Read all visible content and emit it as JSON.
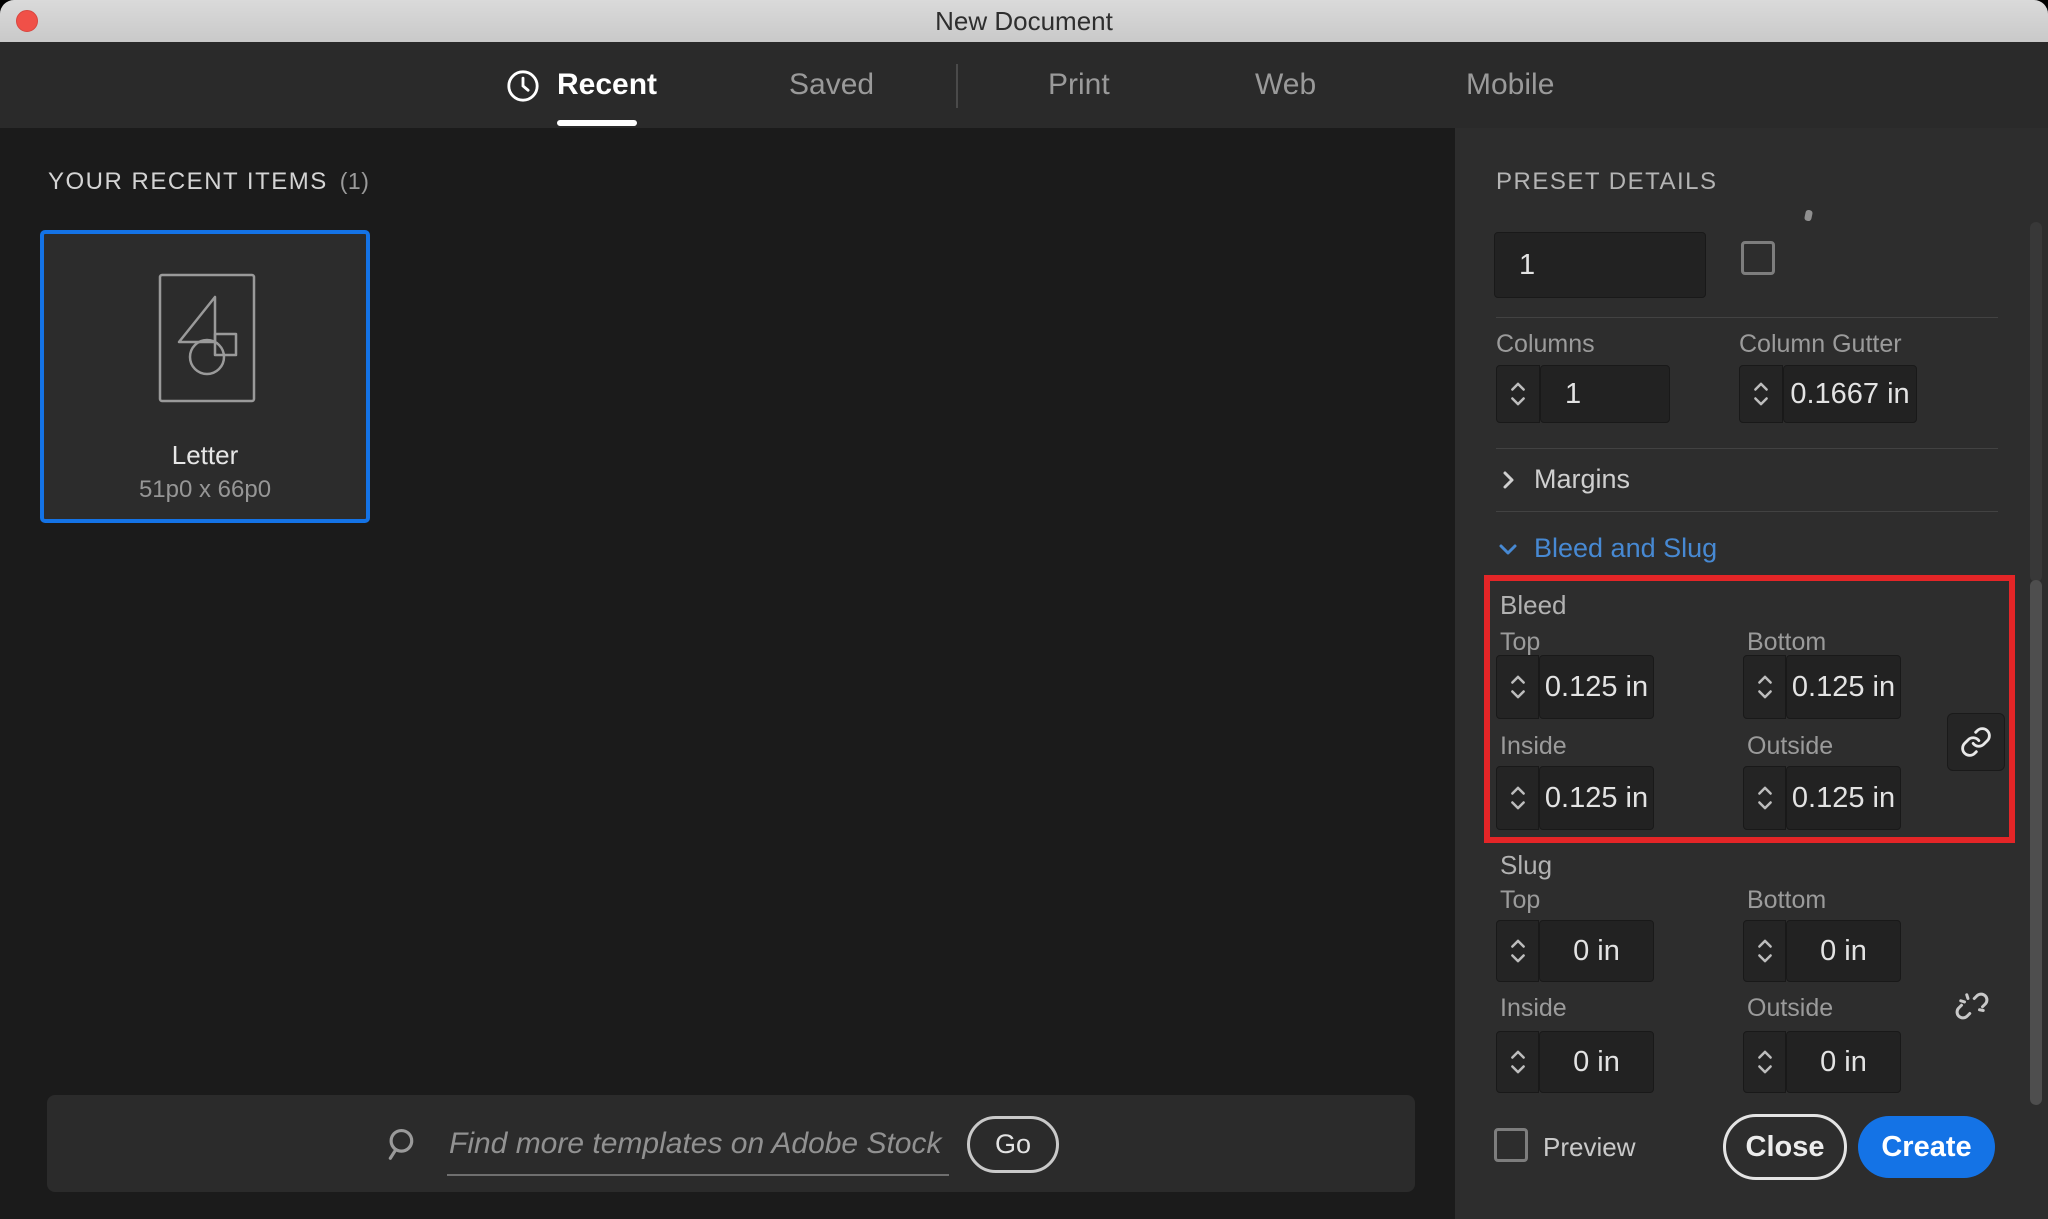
{
  "window": {
    "title": "New Document"
  },
  "tabs": [
    {
      "label": "Recent",
      "active": true
    },
    {
      "label": "Saved",
      "active": false
    },
    {
      "label": "Print",
      "active": false
    },
    {
      "label": "Web",
      "active": false
    },
    {
      "label": "Mobile",
      "active": false
    }
  ],
  "recent": {
    "heading": "YOUR RECENT ITEMS",
    "count": "(1)",
    "card": {
      "name": "Letter",
      "dimensions": "51p0 x 66p0"
    }
  },
  "search": {
    "placeholder": "Find more templates on Adobe Stock",
    "go_label": "Go"
  },
  "panel": {
    "heading": "PRESET DETAILS",
    "pages": {
      "value": "1"
    },
    "columns": {
      "label": "Columns",
      "value": "1"
    },
    "gutter": {
      "label": "Column Gutter",
      "value": "0.1667 in"
    },
    "margins": {
      "label": "Margins"
    },
    "bleed_slug": {
      "label": "Bleed and Slug"
    },
    "bleed": {
      "label": "Bleed",
      "fields": [
        {
          "label": "Top",
          "value": "0.125 in"
        },
        {
          "label": "Bottom",
          "value": "0.125 in"
        },
        {
          "label": "Inside",
          "value": "0.125 in"
        },
        {
          "label": "Outside",
          "value": "0.125 in"
        }
      ]
    },
    "slug": {
      "label": "Slug",
      "fields": [
        {
          "label": "Top",
          "value": "0 in"
        },
        {
          "label": "Bottom",
          "value": "0 in"
        },
        {
          "label": "Inside",
          "value": "0 in"
        },
        {
          "label": "Outside",
          "value": "0 in"
        }
      ]
    },
    "preview_label": "Preview",
    "close_label": "Close",
    "create_label": "Create"
  },
  "colors": {
    "accent_blue": "#1473e6",
    "annotation_red": "#e42527",
    "section_link_blue": "#4789d3",
    "selection_border": "#1473e6"
  }
}
